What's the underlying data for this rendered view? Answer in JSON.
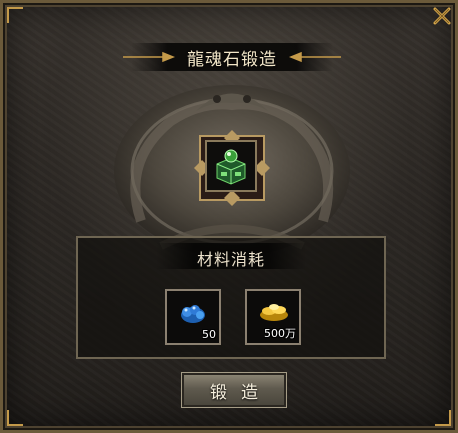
{
  "window": {
    "title": "龍魂石锻造"
  },
  "result_item": {
    "icon": "dragon-soul-stone-icon"
  },
  "materials": {
    "title": "材料消耗",
    "items": [
      {
        "icon": "blue-gem-icon",
        "count": "50"
      },
      {
        "icon": "gold-ingot-icon",
        "count": "500万"
      }
    ]
  },
  "actions": {
    "forge_label": "锻造"
  },
  "colors": {
    "accent_gold": "#c49a4a",
    "title_text": "#f2e6c8"
  }
}
